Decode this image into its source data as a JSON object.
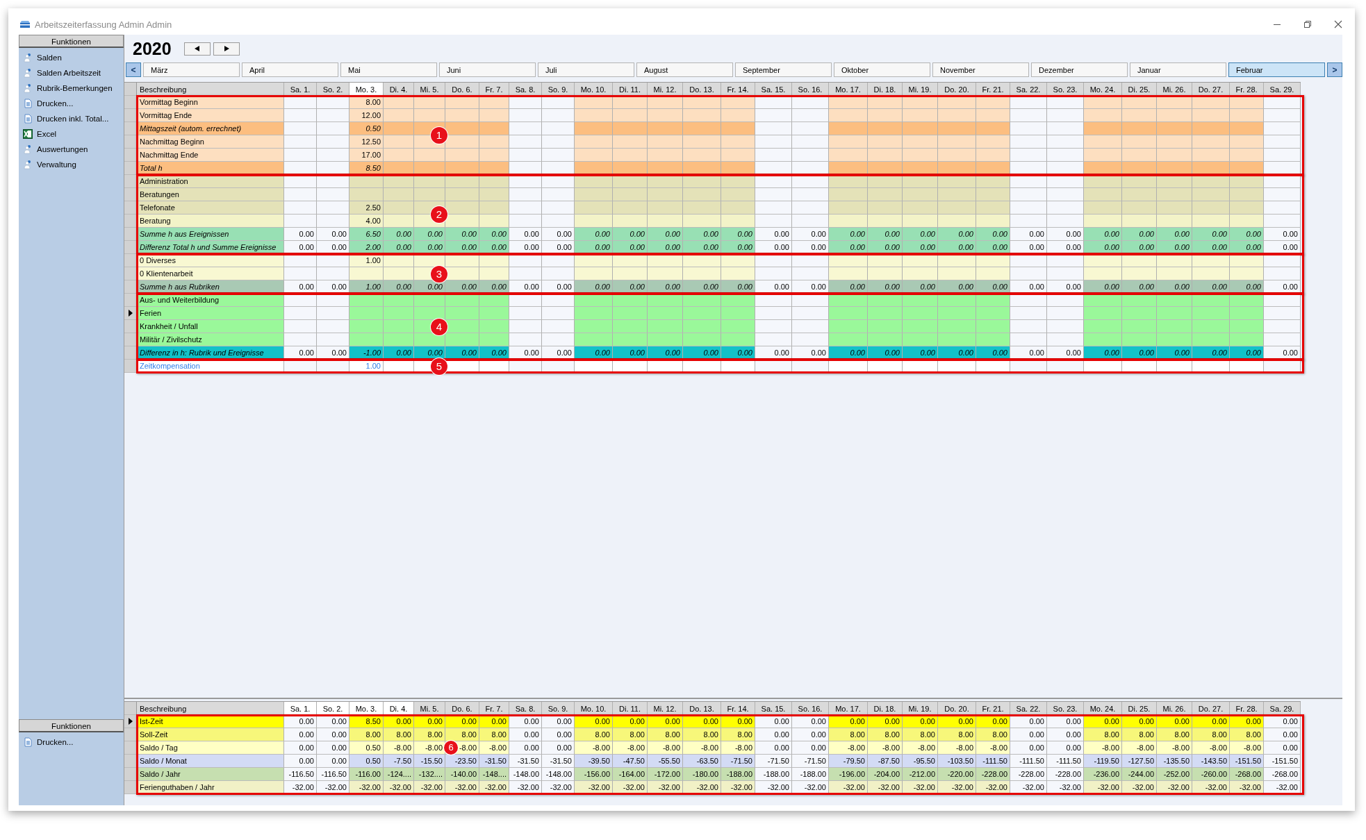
{
  "window": {
    "title": "Arbeitszeiterfassung Admin Admin"
  },
  "sidebar": {
    "title": "Funktionen",
    "items": [
      {
        "label": "Salden",
        "kind": "tool"
      },
      {
        "label": "Salden Arbeitszeit",
        "kind": "tool"
      },
      {
        "label": "Rubrik-Bemerkungen",
        "kind": "tool"
      },
      {
        "label": "Drucken...",
        "kind": "print"
      },
      {
        "label": "Drucken inkl. Total...",
        "kind": "print"
      },
      {
        "label": "Excel",
        "kind": "excel"
      },
      {
        "label": "Auswertungen",
        "kind": "tool"
      },
      {
        "label": "Verwaltung",
        "kind": "tool"
      }
    ]
  },
  "lower_sidebar": {
    "title": "Funktionen",
    "items": [
      {
        "label": "Drucken...",
        "kind": "print"
      }
    ]
  },
  "year": "2020",
  "months": {
    "prev": "<",
    "next": ">",
    "items": [
      {
        "label": "März",
        "selected": false
      },
      {
        "label": "April",
        "selected": false
      },
      {
        "label": "Mai",
        "selected": false
      },
      {
        "label": "Juni",
        "selected": false
      },
      {
        "label": "Juli",
        "selected": false
      },
      {
        "label": "August",
        "selected": false
      },
      {
        "label": "September",
        "selected": false
      },
      {
        "label": "Oktober",
        "selected": false
      },
      {
        "label": "November",
        "selected": false
      },
      {
        "label": "Dezember",
        "selected": false
      },
      {
        "label": "Januar",
        "selected": false
      },
      {
        "label": "Februar",
        "selected": true
      }
    ]
  },
  "upper": {
    "description_header": "Beschreibung",
    "days": [
      {
        "label": "Sa. 1.",
        "weekend": true,
        "selected": false
      },
      {
        "label": "So. 2.",
        "weekend": true,
        "selected": false
      },
      {
        "label": "Mo. 3.",
        "weekend": false,
        "selected": true
      },
      {
        "label": "Di. 4.",
        "weekend": false,
        "selected": false
      },
      {
        "label": "Mi. 5.",
        "weekend": false,
        "selected": false
      },
      {
        "label": "Do. 6.",
        "weekend": false,
        "selected": false
      },
      {
        "label": "Fr. 7.",
        "weekend": false,
        "selected": false
      },
      {
        "label": "Sa. 8.",
        "weekend": true,
        "selected": false
      },
      {
        "label": "So. 9.",
        "weekend": true,
        "selected": false
      },
      {
        "label": "Mo. 10.",
        "weekend": false,
        "selected": false
      },
      {
        "label": "Di. 11.",
        "weekend": false,
        "selected": false
      },
      {
        "label": "Mi. 12.",
        "weekend": false,
        "selected": false
      },
      {
        "label": "Do. 13.",
        "weekend": false,
        "selected": false
      },
      {
        "label": "Fr. 14.",
        "weekend": false,
        "selected": false
      },
      {
        "label": "Sa. 15.",
        "weekend": true,
        "selected": false
      },
      {
        "label": "So. 16.",
        "weekend": true,
        "selected": false
      },
      {
        "label": "Mo. 17.",
        "weekend": false,
        "selected": false
      },
      {
        "label": "Di. 18.",
        "weekend": false,
        "selected": false
      },
      {
        "label": "Mi. 19.",
        "weekend": false,
        "selected": false
      },
      {
        "label": "Do. 20.",
        "weekend": false,
        "selected": false
      },
      {
        "label": "Fr. 21.",
        "weekend": false,
        "selected": false
      },
      {
        "label": "Sa. 22.",
        "weekend": true,
        "selected": false
      },
      {
        "label": "So. 23.",
        "weekend": true,
        "selected": false
      },
      {
        "label": "Mo. 24.",
        "weekend": false,
        "selected": false
      },
      {
        "label": "Di. 25.",
        "weekend": false,
        "selected": false
      },
      {
        "label": "Mi. 26.",
        "weekend": false,
        "selected": false
      },
      {
        "label": "Do. 27.",
        "weekend": false,
        "selected": false
      },
      {
        "label": "Fr. 28.",
        "weekend": false,
        "selected": false
      },
      {
        "label": "Sa. 29.",
        "weekend": true,
        "selected": false
      }
    ],
    "groups": [
      {
        "badge": "1",
        "rows": [
          {
            "label": "Vormittag Beginn",
            "kind": "time",
            "selected": false,
            "cells": [
              {},
              {},
              {
                "value": "8.00"
              }
            ]
          },
          {
            "label": "Vormittag Ende",
            "kind": "time",
            "selected": false,
            "cells": [
              {},
              {},
              {
                "value": "12.00"
              }
            ]
          },
          {
            "label": "Mittagszeit (autom. errechnet)",
            "kind": "timesum",
            "selected": false,
            "cells": [
              {},
              {},
              {
                "value": "0.50"
              }
            ]
          },
          {
            "label": "Nachmittag Beginn",
            "kind": "time",
            "selected": false,
            "cells": [
              {},
              {},
              {
                "value": "12.50"
              }
            ]
          },
          {
            "label": "Nachmittag Ende",
            "kind": "time",
            "selected": false,
            "cells": [
              {},
              {},
              {
                "value": "17.00"
              }
            ]
          },
          {
            "label": "Total h",
            "kind": "timesum",
            "selected": false,
            "cells": [
              {},
              {},
              {
                "value": "8.50"
              }
            ]
          }
        ]
      },
      {
        "badge": "2",
        "rows": [
          {
            "label": "Administration",
            "kind": "event",
            "selected": false
          },
          {
            "label": "Beratungen",
            "kind": "event",
            "selected": false
          },
          {
            "label": "Telefonate",
            "kind": "event",
            "selected": false,
            "cells": [
              {},
              {},
              {
                "value": "2.50"
              }
            ]
          },
          {
            "label": "Beratung",
            "kind": "subevent",
            "selected": false,
            "cells": [
              {},
              {},
              {
                "value": "4.00"
              }
            ]
          },
          {
            "label": "Summe h aus Ereignissen",
            "kind": "eventsum",
            "selected": false,
            "values": [
              "0.00",
              "0.00",
              "6.50",
              "0.00",
              "0.00",
              "0.00",
              "0.00",
              "0.00",
              "0.00",
              "0.00",
              "0.00",
              "0.00",
              "0.00",
              "0.00",
              "0.00",
              "0.00",
              "0.00",
              "0.00",
              "0.00",
              "0.00",
              "0.00",
              "0.00",
              "0.00",
              "0.00",
              "0.00",
              "0.00",
              "0.00",
              "0.00",
              "0.00"
            ]
          },
          {
            "label": "Differenz Total h und Summe Ereignisse",
            "kind": "eventsum",
            "selected": false,
            "values": [
              "0.00",
              "0.00",
              "2.00",
              "0.00",
              "0.00",
              "0.00",
              "0.00",
              "0.00",
              "0.00",
              "0.00",
              "0.00",
              "0.00",
              "0.00",
              "0.00",
              "0.00",
              "0.00",
              "0.00",
              "0.00",
              "0.00",
              "0.00",
              "0.00",
              "0.00",
              "0.00",
              "0.00",
              "0.00",
              "0.00",
              "0.00",
              "0.00",
              "0.00"
            ]
          }
        ]
      },
      {
        "badge": "3",
        "rows": [
          {
            "label": "0 Diverses",
            "kind": "rubric",
            "selected": false,
            "cells": [
              {},
              {},
              {
                "value": "1.00"
              }
            ]
          },
          {
            "label": "0 Klientenarbeit",
            "kind": "rubric",
            "selected": false
          },
          {
            "label": "Summe h aus Rubriken",
            "kind": "rubricsum",
            "selected": false,
            "values": [
              "0.00",
              "0.00",
              "1.00",
              "0.00",
              "0.00",
              "0.00",
              "0.00",
              "0.00",
              "0.00",
              "0.00",
              "0.00",
              "0.00",
              "0.00",
              "0.00",
              "0.00",
              "0.00",
              "0.00",
              "0.00",
              "0.00",
              "0.00",
              "0.00",
              "0.00",
              "0.00",
              "0.00",
              "0.00",
              "0.00",
              "0.00",
              "0.00",
              "0.00"
            ]
          }
        ]
      },
      {
        "badge": "4",
        "rows": [
          {
            "label": "Aus- und Weiterbildung",
            "kind": "absence",
            "selected": false
          },
          {
            "label": "Ferien",
            "kind": "absence",
            "selected": true
          },
          {
            "label": "Krankheit / Unfall",
            "kind": "absence",
            "selected": false
          },
          {
            "label": "Militär / Zivilschutz",
            "kind": "absence",
            "selected": false
          },
          {
            "label": "Differenz in h: Rubrik und Ereignisse",
            "kind": "diff",
            "selected": false,
            "values": [
              "0.00",
              "0.00",
              "-1.00",
              "0.00",
              "0.00",
              "0.00",
              "0.00",
              "0.00",
              "0.00",
              "0.00",
              "0.00",
              "0.00",
              "0.00",
              "0.00",
              "0.00",
              "0.00",
              "0.00",
              "0.00",
              "0.00",
              "0.00",
              "0.00",
              "0.00",
              "0.00",
              "0.00",
              "0.00",
              "0.00",
              "0.00",
              "0.00",
              "0.00"
            ]
          }
        ]
      },
      {
        "badge": "5",
        "rows": [
          {
            "label": "Zeitkompensation",
            "kind": "link",
            "selected": false,
            "cells": [
              {},
              {},
              {
                "value": "1.00"
              }
            ]
          }
        ]
      }
    ]
  },
  "lower": {
    "description_header": "Beschreibung",
    "badge": "6",
    "days": [
      {
        "label": "Sa. 1.",
        "weekend": true,
        "selected": true
      },
      {
        "label": "So. 2.",
        "weekend": true,
        "selected": true
      },
      {
        "label": "Mo. 3.",
        "weekend": false,
        "selected": true
      },
      {
        "label": "Di. 4.",
        "weekend": false,
        "selected": true
      },
      {
        "label": "Mi. 5.",
        "weekend": false,
        "selected": false
      },
      {
        "label": "Do. 6.",
        "weekend": false,
        "selected": false
      },
      {
        "label": "Fr. 7.",
        "weekend": false,
        "selected": false
      },
      {
        "label": "Sa. 8.",
        "weekend": true,
        "selected": false
      },
      {
        "label": "So. 9.",
        "weekend": true,
        "selected": false
      },
      {
        "label": "Mo. 10.",
        "weekend": false,
        "selected": false
      },
      {
        "label": "Di. 11.",
        "weekend": false,
        "selected": false
      },
      {
        "label": "Mi. 12.",
        "weekend": false,
        "selected": false
      },
      {
        "label": "Do. 13.",
        "weekend": false,
        "selected": false
      },
      {
        "label": "Fr. 14.",
        "weekend": false,
        "selected": false
      },
      {
        "label": "Sa. 15.",
        "weekend": true,
        "selected": false
      },
      {
        "label": "So. 16.",
        "weekend": true,
        "selected": false
      },
      {
        "label": "Mo. 17.",
        "weekend": false,
        "selected": false
      },
      {
        "label": "Di. 18.",
        "weekend": false,
        "selected": false
      },
      {
        "label": "Mi. 19.",
        "weekend": false,
        "selected": false
      },
      {
        "label": "Do. 20.",
        "weekend": false,
        "selected": false
      },
      {
        "label": "Fr. 21.",
        "weekend": false,
        "selected": false
      },
      {
        "label": "Sa. 22.",
        "weekend": true,
        "selected": false
      },
      {
        "label": "So. 23.",
        "weekend": true,
        "selected": false
      },
      {
        "label": "Mo. 24.",
        "weekend": false,
        "selected": false
      },
      {
        "label": "Di. 25.",
        "weekend": false,
        "selected": false
      },
      {
        "label": "Mi. 26.",
        "weekend": false,
        "selected": false
      },
      {
        "label": "Do. 27.",
        "weekend": false,
        "selected": false
      },
      {
        "label": "Fr. 28.",
        "weekend": false,
        "selected": false
      },
      {
        "label": "Sa. 29.",
        "weekend": true,
        "selected": false
      }
    ],
    "rows": [
      {
        "label": "Ist-Zeit",
        "kind": "ist",
        "selected": true,
        "values": [
          "0.00",
          "0.00",
          "8.50",
          "0.00",
          "0.00",
          "0.00",
          "0.00",
          "0.00",
          "0.00",
          "0.00",
          "0.00",
          "0.00",
          "0.00",
          "0.00",
          "0.00",
          "0.00",
          "0.00",
          "0.00",
          "0.00",
          "0.00",
          "0.00",
          "0.00",
          "0.00",
          "0.00",
          "0.00",
          "0.00",
          "0.00",
          "0.00",
          "0.00"
        ]
      },
      {
        "label": "Soll-Zeit",
        "kind": "soll",
        "selected": false,
        "values": [
          "0.00",
          "0.00",
          "8.00",
          "8.00",
          "8.00",
          "8.00",
          "8.00",
          "0.00",
          "0.00",
          "8.00",
          "8.00",
          "8.00",
          "8.00",
          "8.00",
          "0.00",
          "0.00",
          "8.00",
          "8.00",
          "8.00",
          "8.00",
          "8.00",
          "0.00",
          "0.00",
          "8.00",
          "8.00",
          "8.00",
          "8.00",
          "8.00",
          "0.00"
        ]
      },
      {
        "label": "Saldo / Tag",
        "kind": "saldotag",
        "selected": false,
        "values": [
          "0.00",
          "0.00",
          "0.50",
          "-8.00",
          "-8.00",
          "-8.00",
          "-8.00",
          "0.00",
          "0.00",
          "-8.00",
          "-8.00",
          "-8.00",
          "-8.00",
          "-8.00",
          "0.00",
          "0.00",
          "-8.00",
          "-8.00",
          "-8.00",
          "-8.00",
          "-8.00",
          "0.00",
          "0.00",
          "-8.00",
          "-8.00",
          "-8.00",
          "-8.00",
          "-8.00",
          "0.00"
        ]
      },
      {
        "label": "Saldo / Monat",
        "kind": "saldomonat",
        "selected": false,
        "values": [
          "0.00",
          "0.00",
          "0.50",
          "-7.50",
          "-15.50",
          "-23.50",
          "-31.50",
          "-31.50",
          "-31.50",
          "-39.50",
          "-47.50",
          "-55.50",
          "-63.50",
          "-71.50",
          "-71.50",
          "-71.50",
          "-79.50",
          "-87.50",
          "-95.50",
          "-103.50",
          "-111.50",
          "-111.50",
          "-111.50",
          "-119.50",
          "-127.50",
          "-135.50",
          "-143.50",
          "-151.50",
          "-151.50"
        ]
      },
      {
        "label": "Saldo / Jahr",
        "kind": "saldojahr",
        "selected": false,
        "values": [
          "-116.50",
          "-116.50",
          "-116.00",
          "-124....",
          "-132....",
          "-140.00",
          "-148....",
          "-148.00",
          "-148.00",
          "-156.00",
          "-164.00",
          "-172.00",
          "-180.00",
          "-188.00",
          "-188.00",
          "-188.00",
          "-196.00",
          "-204.00",
          "-212.00",
          "-220.00",
          "-228.00",
          "-228.00",
          "-228.00",
          "-236.00",
          "-244.00",
          "-252.00",
          "-260.00",
          "-268.00",
          "-268.00"
        ]
      },
      {
        "label": "Ferienguthaben / Jahr",
        "kind": "ferien",
        "selected": false,
        "values": [
          "-32.00",
          "-32.00",
          "-32.00",
          "-32.00",
          "-32.00",
          "-32.00",
          "-32.00",
          "-32.00",
          "-32.00",
          "-32.00",
          "-32.00",
          "-32.00",
          "-32.00",
          "-32.00",
          "-32.00",
          "-32.00",
          "-32.00",
          "-32.00",
          "-32.00",
          "-32.00",
          "-32.00",
          "-32.00",
          "-32.00",
          "-32.00",
          "-32.00",
          "-32.00",
          "-32.00",
          "-32.00",
          "-32.00"
        ]
      }
    ]
  }
}
